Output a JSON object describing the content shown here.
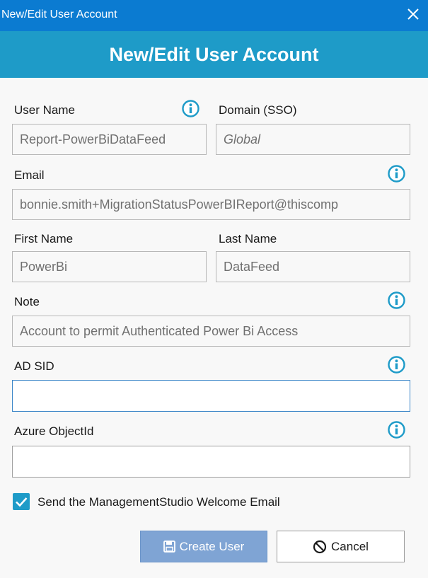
{
  "window": {
    "title": "New/Edit User Account",
    "close_icon": "close-icon"
  },
  "header": {
    "title": "New/Edit User Account"
  },
  "form": {
    "username": {
      "label": "User Name",
      "value": "Report-PowerBiDataFeed"
    },
    "domain": {
      "label": "Domain (SSO)",
      "value": "Global"
    },
    "email": {
      "label": "Email",
      "value": "bonnie.smith+MigrationStatusPowerBIReport@thiscomp"
    },
    "first_name": {
      "label": "First Name",
      "value": "PowerBi"
    },
    "last_name": {
      "label": "Last Name",
      "value": "DataFeed"
    },
    "note": {
      "label": "Note",
      "value": "Account to permit Authenticated Power Bi Access"
    },
    "ad_sid": {
      "label": "AD SID",
      "value": ""
    },
    "azure_object_id": {
      "label": "Azure ObjectId",
      "value": ""
    },
    "welcome_email": {
      "label": "Send the ManagementStudio Welcome Email",
      "checked": true
    }
  },
  "buttons": {
    "create_label": "Create User",
    "cancel_label": "Cancel"
  },
  "colors": {
    "titlebar": "#0b7bd1",
    "header": "#1e9bc8",
    "info_icon": "#1e9bc8",
    "create_button": "#7fa4d4"
  }
}
